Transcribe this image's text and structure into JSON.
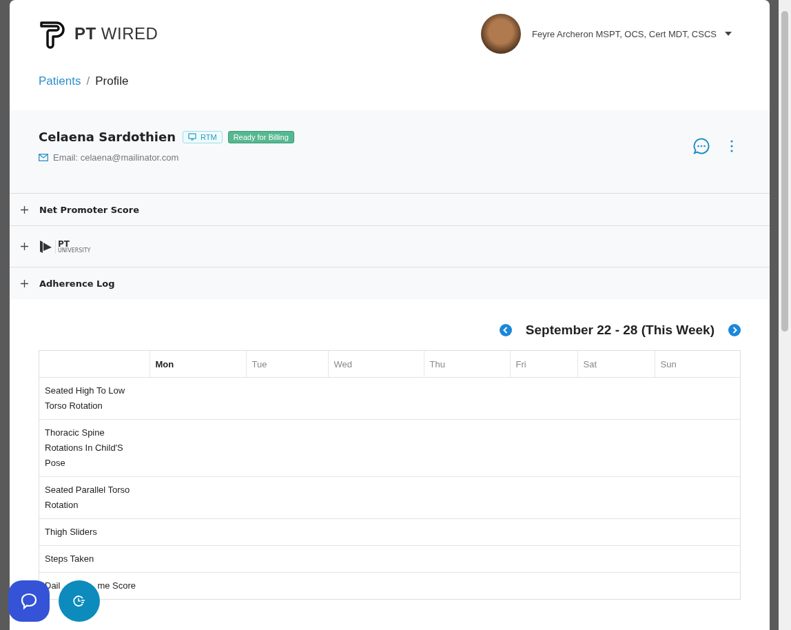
{
  "header": {
    "logo": {
      "bold": "PT",
      "light": "WIRED"
    },
    "user": {
      "name": "Feyre Archeron MSPT, OCS, Cert MDT, CSCS"
    }
  },
  "breadcrumb": [
    {
      "label": "Patients",
      "link": true
    },
    {
      "label": "/",
      "kind": "separator"
    },
    {
      "label": "Profile",
      "link": false
    }
  ],
  "patient": {
    "name": "Celaena Sardothien",
    "tags": [
      {
        "kind": "rtm",
        "label": "RTM"
      },
      {
        "kind": "status",
        "label": "Ready for Billing"
      }
    ],
    "email": "Email: celaena@mailinator.com"
  },
  "sections": [
    {
      "kind": "text",
      "label": "Net Promoter Score",
      "expanded": false
    },
    {
      "kind": "logo",
      "bold": "PT",
      "light": "UNIVERSITY",
      "expanded": false
    },
    {
      "kind": "text",
      "label": "Adherence Log",
      "expanded": false
    }
  ],
  "week": {
    "title": "September 22 - 28 (This Week)"
  },
  "table": {
    "columns": [
      {
        "label": "Mon",
        "selected": true
      },
      {
        "label": "Tue",
        "selected": false
      },
      {
        "label": "Wed",
        "selected": false
      },
      {
        "label": "Thu",
        "selected": false
      },
      {
        "label": "Fri",
        "selected": false
      },
      {
        "label": "Sat",
        "selected": false
      },
      {
        "label": "Sun",
        "selected": false
      }
    ],
    "rows": [
      "Seated High To Low Torso Rotation",
      "Thoracic Spine Rotations In Child'S Pose",
      "Seated Parallel Torso Rotation",
      "Thigh Sliders",
      "Steps Taken",
      [
        "Dail",
        "me Score"
      ]
    ]
  }
}
